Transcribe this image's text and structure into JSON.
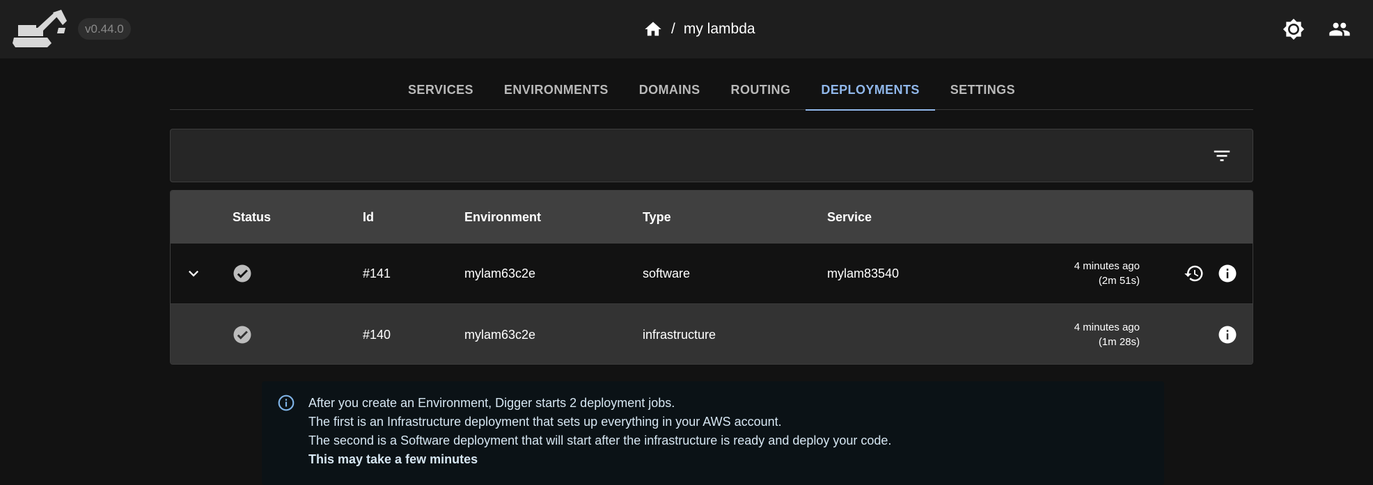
{
  "header": {
    "version": "v0.44.0",
    "breadcrumb_separator": "/",
    "project_name": "my lambda"
  },
  "tabs": [
    {
      "label": "SERVICES",
      "active": false
    },
    {
      "label": "ENVIRONMENTS",
      "active": false
    },
    {
      "label": "DOMAINS",
      "active": false
    },
    {
      "label": "ROUTING",
      "active": false
    },
    {
      "label": "DEPLOYMENTS",
      "active": true
    },
    {
      "label": "SETTINGS",
      "active": false
    }
  ],
  "table": {
    "columns": [
      "Status",
      "Id",
      "Environment",
      "Type",
      "Service"
    ],
    "rows": [
      {
        "status": "success",
        "id": "#141",
        "environment": "mylam63c2e",
        "type": "software",
        "service": "mylam83540",
        "time_ago": "4 minutes ago",
        "duration": "(2m 51s)"
      },
      {
        "status": "success",
        "id": "#140",
        "environment": "mylam63c2e",
        "type": "infrastructure",
        "service": "",
        "time_ago": "4 minutes ago",
        "duration": "(1m 28s)"
      }
    ]
  },
  "info": {
    "line1": "After you create an Environment, Digger starts 2 deployment jobs.",
    "line2": "The first is an Infrastructure deployment that sets up everything in your AWS account.",
    "line3": "The second is a Software deployment that will start after the infrastructure is ready and deploy your code.",
    "line4": "This may take a few minutes"
  },
  "colors": {
    "accent": "#90b7ea",
    "topbar": "#1e1e1e",
    "background": "#121212",
    "table_header": "#404040"
  }
}
